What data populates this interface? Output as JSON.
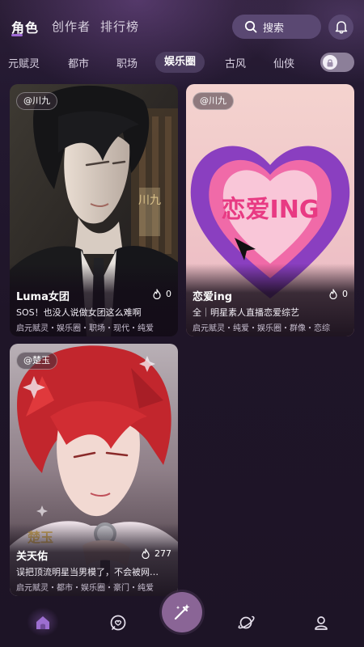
{
  "nav": {
    "tabs": [
      {
        "label": "角色",
        "active": true
      },
      {
        "label": "创作者",
        "active": false
      },
      {
        "label": "排行榜",
        "active": false
      }
    ],
    "search_label": "搜索"
  },
  "categories": [
    "元赋灵",
    "都市",
    "职场",
    "娱乐圈",
    "古风",
    "仙侠"
  ],
  "active_category": "娱乐圈",
  "cards": [
    {
      "author": "@川九",
      "title": "Luma女团",
      "likes": "0",
      "desc": "SOS！也没人说做女团这么难啊",
      "tags": "启元赋灵・娱乐圈・职场・现代・纯爱",
      "art_text": "川九"
    },
    {
      "author": "@川九",
      "title": "恋爱ing",
      "likes": "0",
      "desc": "全｜明星素人直播恋爱综艺",
      "tags": "启元赋灵・纯爱・娱乐圈・群像・恋综",
      "art_text": "恋爱ING"
    },
    {
      "author": "@楚玉",
      "title": "关天佑",
      "likes": "277",
      "desc": "误把顶流明星当男模了，不会被网…",
      "tags": "启元赋灵・都市・娱乐圈・豪门・纯爱",
      "art_text": "楚玉"
    }
  ],
  "colors": {
    "background": "#1f1528",
    "accent": "#a06ad6",
    "chip": "#5a4872",
    "heart_outer": "#8a3fc0",
    "heart_inner": "#f06aa8",
    "create_button": "#8a6596"
  },
  "icons": {
    "search": "search-icon",
    "bell": "bell-icon",
    "toggle": "lock-icon",
    "likes": "flame-icon",
    "home": "home-icon",
    "chat": "chat-icon",
    "create": "magic-wand-icon",
    "explore": "planet-icon",
    "profile": "user-icon"
  }
}
